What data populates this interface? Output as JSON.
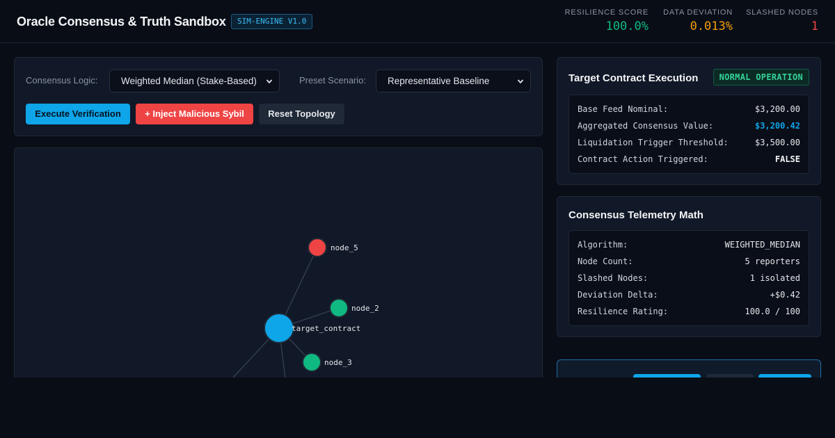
{
  "header": {
    "title": "Oracle Consensus & Truth Sandbox",
    "version_badge": "SIM-ENGINE V1.0",
    "stats": {
      "resilience": {
        "label": "Resilience Score",
        "value": "100.0%",
        "color": "#10b981"
      },
      "deviation": {
        "label": "Data Deviation",
        "value": "0.013%",
        "color": "#f59e0b"
      },
      "slashed": {
        "label": "Slashed Nodes",
        "value": "1",
        "color": "#ef4444"
      }
    }
  },
  "controls": {
    "consensus_label": "Consensus Logic:",
    "consensus_value": "Weighted Median (Stake-Based)",
    "preset_label": "Preset Scenario:",
    "preset_value": "Representative Baseline",
    "execute_label": "Execute Verification",
    "inject_label": "+ Inject Malicious Sybil",
    "reset_label": "Reset Topology"
  },
  "graph": {
    "nodes": [
      {
        "id": "node_5",
        "label": "node_5",
        "status": "slashed",
        "color": "#ef4444"
      },
      {
        "id": "node_2",
        "label": "node_2",
        "status": "honest",
        "color": "#10b981"
      },
      {
        "id": "target_contract",
        "label": "target_contract",
        "status": "contract",
        "color": "#0ea5e9"
      },
      {
        "id": "node_3",
        "label": "node_3",
        "status": "honest",
        "color": "#10b981"
      }
    ]
  },
  "execution": {
    "title": "Target Contract Execution",
    "status_badge": "NORMAL OPERATION",
    "rows": [
      {
        "key": "Base Feed Nominal:",
        "value": "$3,200.00"
      },
      {
        "key": "Aggregated Consensus Value:",
        "value": "$3,200.42",
        "color": "#0ea5e9"
      },
      {
        "key": "Liquidation Trigger Threshold:",
        "value": "$3,500.00"
      },
      {
        "key": "Contract Action Triggered:",
        "value": "FALSE"
      }
    ]
  },
  "telemetry": {
    "title": "Consensus Telemetry Math",
    "rows": [
      {
        "key": "Algorithm:",
        "value": "WEIGHTED_MEDIAN"
      },
      {
        "key": "Node Count:",
        "value": "5 reporters"
      },
      {
        "key": "Slashed Nodes:",
        "value": "1 isolated"
      },
      {
        "key": "Deviation Delta:",
        "value": "+$0.42"
      },
      {
        "key": "Resilience Rating:",
        "value": "100.0 / 100"
      }
    ]
  }
}
